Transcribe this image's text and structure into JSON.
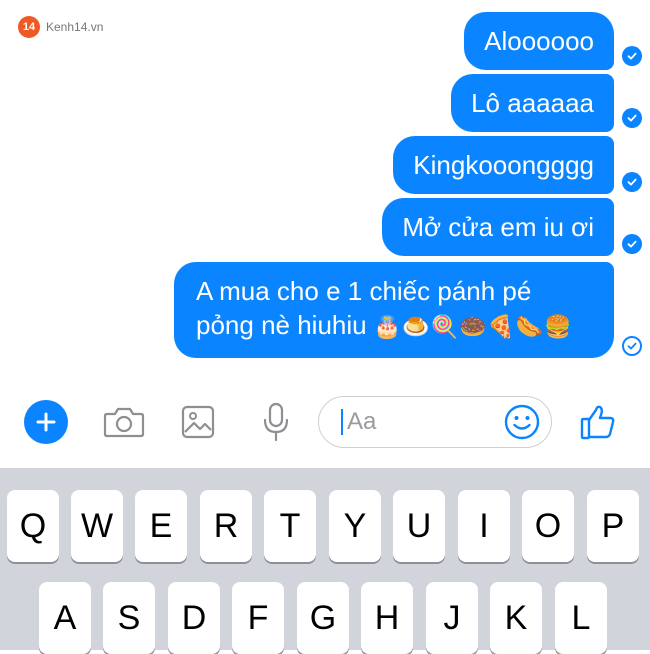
{
  "watermark": {
    "logo": "14",
    "text": "Kenh14.vn"
  },
  "messages": [
    {
      "text": "Aloooooo",
      "status": "seen"
    },
    {
      "text": "Lô aaaaaa",
      "status": "seen"
    },
    {
      "text": "Kingkooongggg",
      "status": "seen"
    },
    {
      "text": "Mở cửa em iu ơi",
      "status": "seen"
    },
    {
      "text": "A mua cho e 1 chiếc pánh pé pỏng nè hiuhiu",
      "emojis": "🎂🍮🍭🍩🍕🌭🍔",
      "status": "sent"
    }
  ],
  "composer": {
    "placeholder": "Aa",
    "icons": [
      "plus-icon",
      "camera-icon",
      "image-icon",
      "microphone-icon",
      "emoji-icon",
      "thumbs-up-icon"
    ]
  },
  "keyboard": {
    "row1": [
      "Q",
      "W",
      "E",
      "R",
      "T",
      "Y",
      "U",
      "I",
      "O",
      "P"
    ],
    "row2": [
      "A",
      "S",
      "D",
      "F",
      "G",
      "H",
      "J",
      "K",
      "L"
    ]
  },
  "colors": {
    "accent": "#0a84ff",
    "keyboard_bg": "#d1d4da"
  }
}
